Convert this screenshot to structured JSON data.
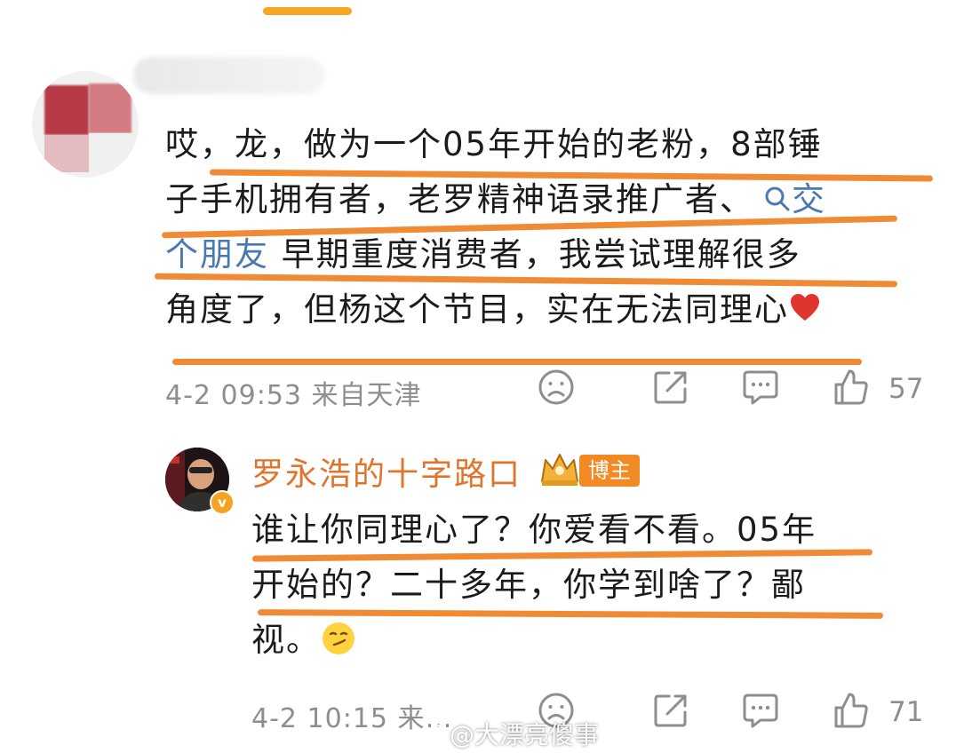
{
  "colors": {
    "accent": "#f5a623",
    "underline": "#f08a35",
    "link": "#4a78b0",
    "username": "#e0742a",
    "meta": "#8e8e8e"
  },
  "comment1": {
    "lines": [
      "哎，龙，做为一个05年开始的老粉，8部锤",
      "子手机拥有者，老罗精神语录推广者、",
      "早期重度消费者，我尝试理解很多",
      "角度了，但杨这个节目，实在无法同理心"
    ],
    "topic_link": "交个朋友",
    "topic_part1": "交",
    "topic_part2": "个朋友",
    "emoji": "heart",
    "timestamp": "4-2 09:53",
    "location": "来自天津",
    "like_count": "57"
  },
  "comment2": {
    "username": "罗永浩的十字路口",
    "author_badge": "博主",
    "lines": [
      "谁让你同理心了？你爱看不看。05年",
      "开始的？二十多年，你学到啥了？鄙",
      "视。"
    ],
    "emoji": "smirk-face",
    "timestamp": "4-2 10:15",
    "location_truncated": "来…",
    "like_count": "71"
  },
  "watermark": "@大漂亮傻事",
  "icons": [
    "dislike-face-icon",
    "share-icon",
    "comment-icon",
    "like-thumb-icon",
    "search-icon",
    "crown-icon",
    "verified-icon"
  ]
}
